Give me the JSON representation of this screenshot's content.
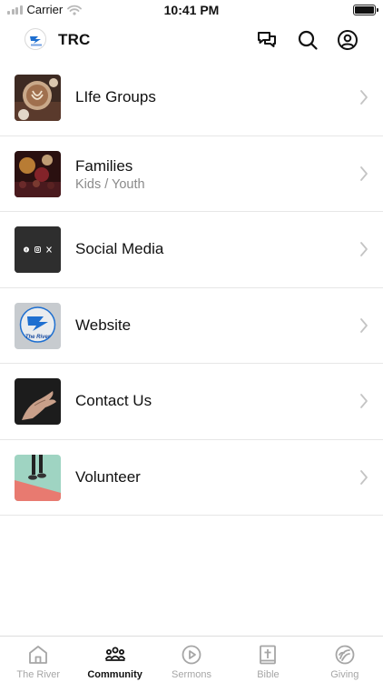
{
  "status_bar": {
    "carrier": "Carrier",
    "time": "10:41 PM"
  },
  "header": {
    "title": "TRC",
    "logo_icon": "church-logo-icon",
    "actions": [
      "chat-icon",
      "search-icon",
      "profile-icon"
    ]
  },
  "items": [
    {
      "title": "LIfe Groups",
      "subtitle": "",
      "thumb": "coffee-cups"
    },
    {
      "title": "Families",
      "subtitle": "Kids / Youth",
      "thumb": "concert-lights"
    },
    {
      "title": "Social Media",
      "subtitle": "",
      "thumb": "social-icons",
      "thumb_text": "f ◎ 𝕏"
    },
    {
      "title": "Website",
      "subtitle": "",
      "thumb": "the-river-logo",
      "thumb_text": "The River"
    },
    {
      "title": "Contact Us",
      "subtitle": "",
      "thumb": "open-hand"
    },
    {
      "title": "Volunteer",
      "subtitle": "",
      "thumb": "shoes-on-color"
    }
  ],
  "tabs": [
    {
      "label": "The River",
      "icon": "home-icon",
      "active": false
    },
    {
      "label": "Community",
      "icon": "people-icon",
      "active": true
    },
    {
      "label": "Sermons",
      "icon": "play-icon",
      "active": false
    },
    {
      "label": "Bible",
      "icon": "bible-icon",
      "active": false
    },
    {
      "label": "Giving",
      "icon": "giving-icon",
      "active": false
    }
  ],
  "colors": {
    "active_tab": "#111111",
    "inactive_tab": "#a6a6a6",
    "subtitle": "#8a8a8a",
    "divider": "#e6e6e6"
  }
}
